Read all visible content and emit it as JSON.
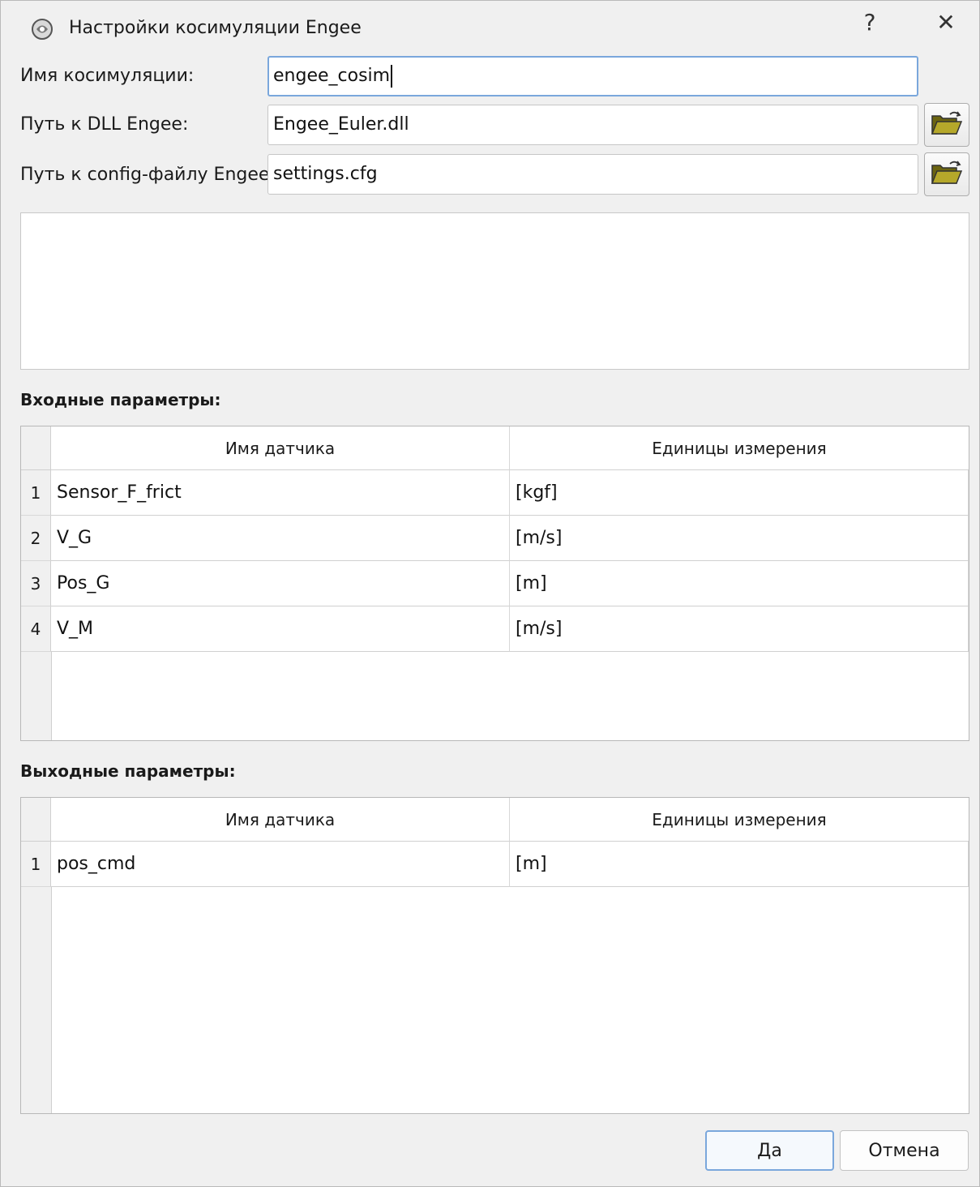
{
  "window": {
    "title": "Настройки косимуляции Engee",
    "help_glyph": "?",
    "close_glyph": "✕"
  },
  "form": {
    "name_label": "Имя косимуляции:",
    "name_value": "engee_cosim",
    "dll_label": "Путь к DLL Engee:",
    "dll_value": "Engee_Euler.dll",
    "config_label": "Путь к config-файлу Engee:",
    "config_value": "settings.cfg"
  },
  "icons": {
    "app": "engee-app-icon",
    "browse": "open-folder-icon"
  },
  "inputs": {
    "label": "Входные параметры:",
    "columns": [
      "Имя датчика",
      "Единицы измерения"
    ],
    "rows": [
      {
        "num": "1",
        "name": "Sensor_F_frict",
        "unit": "[kgf]"
      },
      {
        "num": "2",
        "name": "V_G",
        "unit": "[m/s]"
      },
      {
        "num": "3",
        "name": "Pos_G",
        "unit": "[m]"
      },
      {
        "num": "4",
        "name": "V_M",
        "unit": "[m/s]"
      }
    ]
  },
  "outputs": {
    "label": "Выходные параметры:",
    "columns": [
      "Имя датчика",
      "Единицы измерения"
    ],
    "rows": [
      {
        "num": "1",
        "name": "pos_cmd",
        "unit": "[m]"
      }
    ]
  },
  "buttons": {
    "ok": "Да",
    "cancel": "Отмена"
  },
  "colors": {
    "focus_border": "#7aa7dc",
    "folder": "#8a7f1c"
  }
}
